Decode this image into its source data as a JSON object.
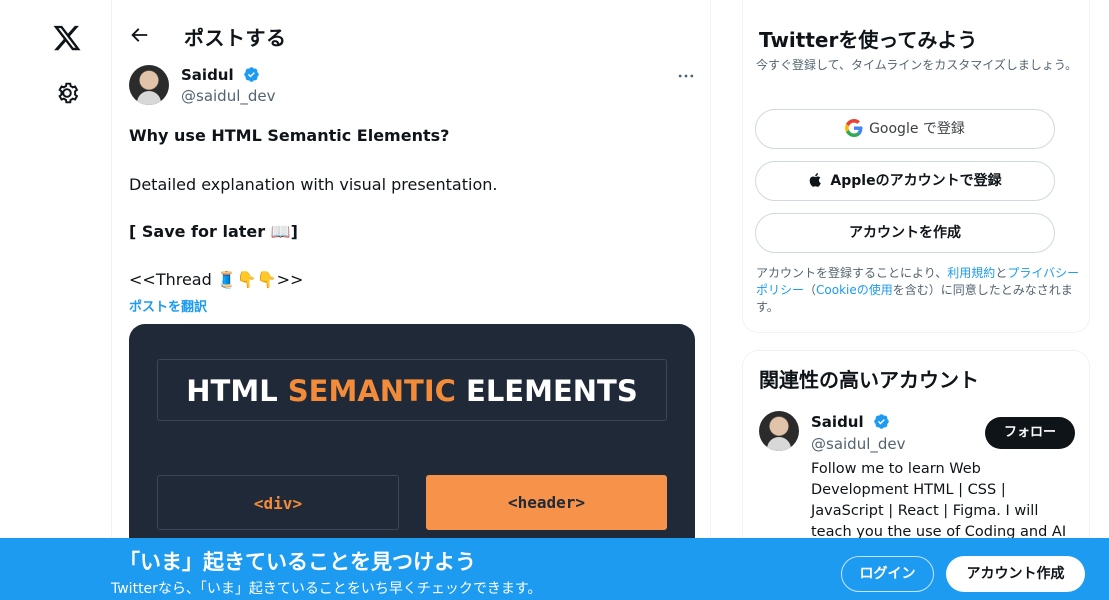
{
  "nav": {
    "logo_icon": "x-logo-icon",
    "settings_icon": "gear-icon"
  },
  "header": {
    "back_icon": "arrow-left-icon",
    "title": "ポストする"
  },
  "post": {
    "author_name": "Saidul",
    "author_handle": "@saidul_dev",
    "verified": true,
    "more_icon": "more-horizontal-icon",
    "line1": "Why use HTML Semantic Elements?",
    "line2": "Detailed explanation with visual presentation.",
    "line3": "[ Save for later 📖]",
    "line4": "<<Thread 🧵👇👇>>",
    "translate_link": "ポストを翻訳",
    "media": {
      "title_part1": "HTML ",
      "title_part2": "SEMANTIC",
      "title_part3": " ELEMENTS",
      "tag1": "<div>",
      "tag2": "<header>",
      "accent_color": "#f38c3a",
      "background_color": "#1f2937"
    }
  },
  "signup_card": {
    "title": "Twitterを使ってみよう",
    "description": "今すぐ登録して、タイムラインをカスタマイズしましょう。",
    "google_button": "Google で登録",
    "apple_button": "Appleのアカウントで登録",
    "create_button": "アカウントを作成",
    "terms_prefix": "アカウントを登録することにより、",
    "terms_link": "利用規約",
    "terms_and": "と",
    "privacy_link": "プライバシーポリシー",
    "terms_paren_open": "（",
    "cookie_link": "Cookieの使用",
    "terms_suffix": "を含む）に同意したとみなされます。"
  },
  "recommend_card": {
    "title": "関連性の高いアカウント",
    "name": "Saidul",
    "handle": "@saidul_dev",
    "follow_button": "フォロー",
    "bio": "Follow me to learn Web Development HTML | CSS | JavaScript | React | Figma. I will teach you the use of Coding and AI to make a profitable"
  },
  "banner": {
    "title": "「いま」起きていることを見つけよう",
    "subtitle": "Twitterなら、「いま」起きていることをいち早くチェックできます。",
    "login_button": "ログイン",
    "signup_button": "アカウント作成",
    "color": "#1d9bf0"
  }
}
